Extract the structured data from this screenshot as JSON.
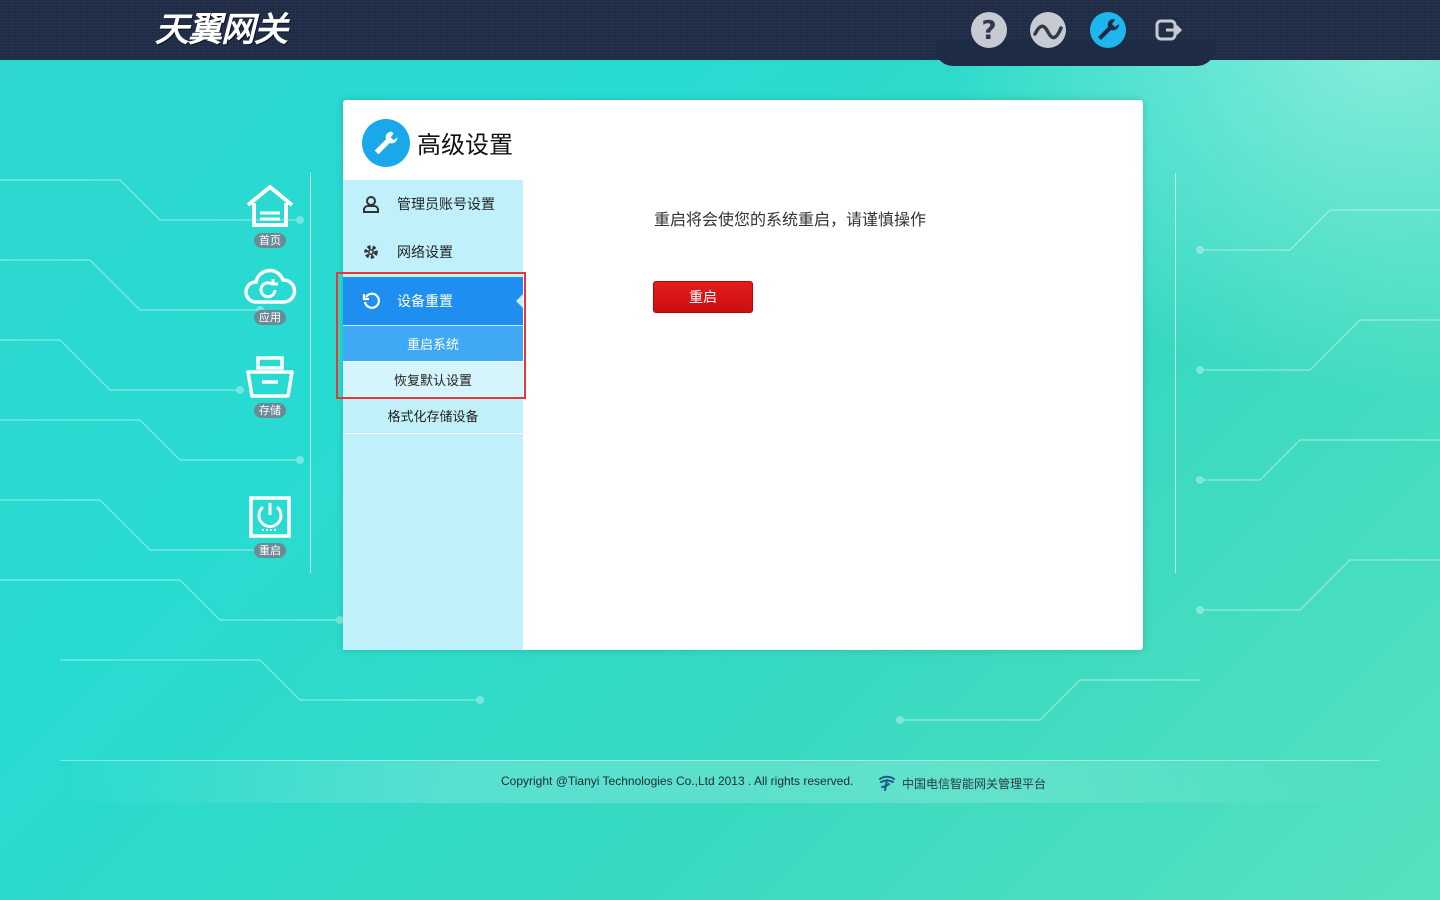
{
  "header": {
    "logo_text": "天翼网关",
    "icons": [
      {
        "name": "help-icon"
      },
      {
        "name": "network-status-icon"
      },
      {
        "name": "wrench-icon",
        "active": true
      },
      {
        "name": "logout-icon"
      }
    ]
  },
  "sidenav": {
    "items": [
      {
        "label": "首页",
        "icon": "home-icon"
      },
      {
        "label": "应用",
        "icon": "cloud-icon"
      },
      {
        "label": "存储",
        "icon": "storage-icon"
      },
      {
        "label": "重启",
        "icon": "power-icon"
      }
    ]
  },
  "panel": {
    "title": "高级设置",
    "menu": [
      {
        "label": "管理员账号设置",
        "icon": "user-icon"
      },
      {
        "label": "网络设置",
        "icon": "gear-icon"
      },
      {
        "label": "设备重置",
        "icon": "reset-icon",
        "active": true
      }
    ],
    "submenu": [
      {
        "label": "重启系统",
        "active": true
      },
      {
        "label": "恢复默认设置"
      },
      {
        "label": "格式化存储设备"
      }
    ],
    "message": "重启将会使您的系统重启，请谨慎操作",
    "reboot_button": "重启"
  },
  "footer": {
    "copyright": "Copyright @Tianyi Technologies Co.,Ltd 2013 . All rights reserved.",
    "platform": "中国电信智能网关管理平台"
  },
  "colors": {
    "topbar": "#1e2b45",
    "accent": "#1e8ff0",
    "button_red": "#d61414",
    "submenu_bg": "#c0f1fb"
  }
}
